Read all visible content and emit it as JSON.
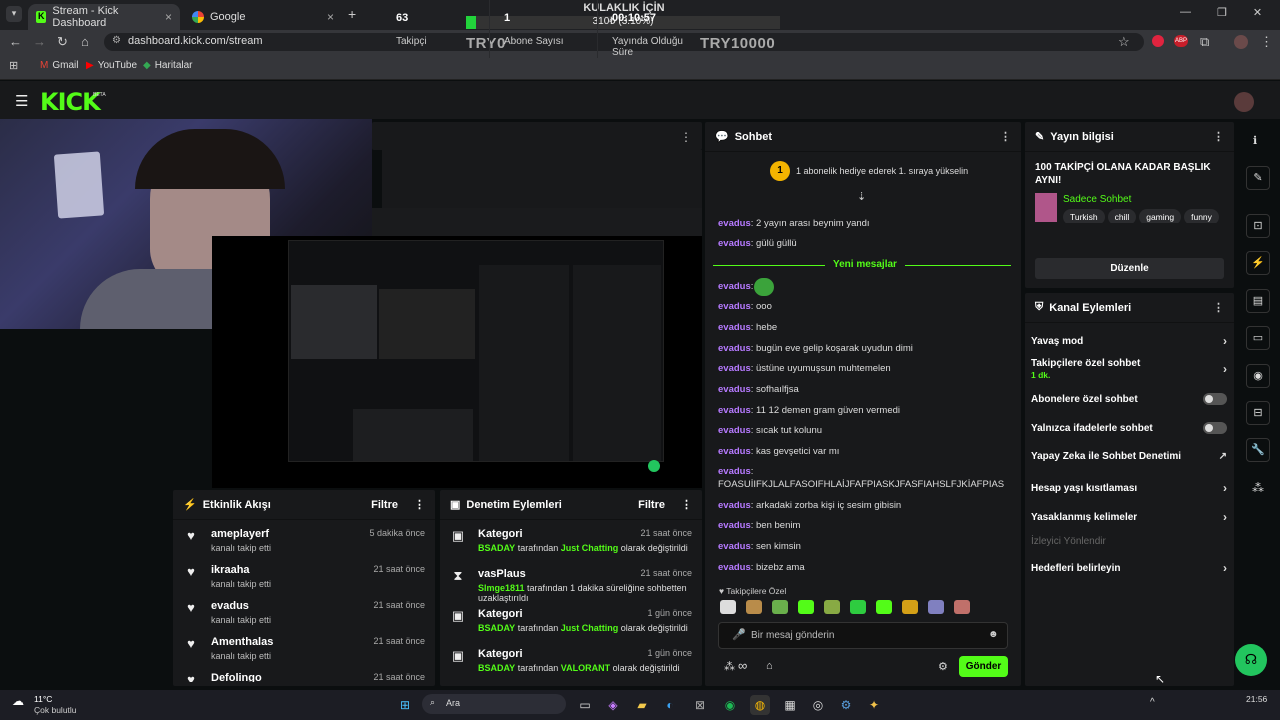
{
  "browser": {
    "tabs": [
      {
        "label": "Stream - Kick Dashboard"
      },
      {
        "label": "Google"
      }
    ],
    "url": "dashboard.kick.com/stream",
    "bookmarks": [
      "Gmail",
      "YouTube",
      "Haritalar"
    ]
  },
  "overlay": {
    "title": "KULAKLIK İÇİN",
    "progress_text": "310₺ (3.10%)",
    "progress_fraction": 0.031,
    "start_label": "TRY0",
    "goal_label": "TRY10000"
  },
  "header": {
    "logo": "KICK",
    "beta": "BETA"
  },
  "stats": [
    {
      "value": "63",
      "label": "Takipçi"
    },
    {
      "value": "1",
      "label": "Abone Sayısı"
    },
    {
      "value": "00:10:57",
      "label": "Yayında Olduğu Süre"
    }
  ],
  "activity": {
    "title": "Etkinlik Akışı",
    "filter": "Filtre",
    "items": [
      {
        "name": "ameplayerf",
        "sub": "kanalı takip etti",
        "time": "5 dakika önce"
      },
      {
        "name": "ikraaha",
        "sub": "kanalı takip etti",
        "time": "21 saat önce"
      },
      {
        "name": "evadus",
        "sub": "kanalı takip etti",
        "time": "21 saat önce"
      },
      {
        "name": "Amenthalas",
        "sub": "kanalı takip etti",
        "time": "21 saat önce"
      },
      {
        "name": "Defolingo",
        "sub": "",
        "time": "21 saat önce"
      }
    ]
  },
  "moderation": {
    "title": "Denetim Eylemleri",
    "filter": "Filtre",
    "items": [
      {
        "name": "Kategori",
        "actor": "BSADAY",
        "mid": " tarafından ",
        "target": "Just Chatting",
        "end": " olarak değiştirildi",
        "time": "21 saat önce"
      },
      {
        "name": "vasPlaus",
        "actor": "Slmge1811",
        "mid": " tarafından 1 dakika süreliğine sohbetten uzaklaştırıldı",
        "target": "",
        "end": "",
        "time": "21 saat önce"
      },
      {
        "name": "Kategori",
        "actor": "BSADAY",
        "mid": " tarafından ",
        "target": "Just Chatting",
        "end": " olarak değiştirildi",
        "time": "1 gün önce"
      },
      {
        "name": "Kategori",
        "actor": "BSADAY",
        "mid": " tarafından ",
        "target": "VALORANT",
        "end": " olarak değiştirildi",
        "time": "1 gün önce"
      }
    ]
  },
  "chat": {
    "title": "Sohbet",
    "banner": "1 abonelik hediye ederek 1. sıraya yükselin",
    "new_messages": "Yeni mesajlar",
    "messages_before": [
      {
        "user": "evadus",
        "text": ": 2 yayın arası beynim yandı"
      },
      {
        "user": "evadus",
        "text": ": gülü güllü"
      }
    ],
    "messages_after": [
      {
        "user": "evadus",
        "text": ":"
      },
      {
        "user": "evadus",
        "text": ": ooo"
      },
      {
        "user": "evadus",
        "text": ": hebe"
      },
      {
        "user": "evadus",
        "text": ": bugün eve gelip koşarak uyudun dimi"
      },
      {
        "user": "evadus",
        "text": ": üstüne uyumuşsun muhtemelen"
      },
      {
        "user": "evadus",
        "text": ": sofhaılfjsa"
      },
      {
        "user": "evadus",
        "text": ": 11 12 demen gram güven vermedi"
      },
      {
        "user": "evadus",
        "text": ": sıcak tut kolunu"
      },
      {
        "user": "evadus",
        "text": ": kas gevşetici var mı"
      },
      {
        "user": "evadus",
        "text": ": FOASUİIFKJLALFASOIFHLAİJFAFPIASKJFASFIAHSLFJKİAFPIAS"
      },
      {
        "user": "evadus",
        "text": ": arkadaki zorba kişi iç sesim gibisin"
      },
      {
        "user": "evadus",
        "text": ": ben benim"
      },
      {
        "user": "evadus",
        "text": ": sen kimsin"
      },
      {
        "user": "evadus",
        "text": ": bizebz ama"
      }
    ],
    "emote_label": "Takipçilere Özel",
    "input_placeholder": "Bir mesaj gönderin",
    "send": "Gönder"
  },
  "stream_info": {
    "title": "Yayın bilgisi",
    "stream_title": "100 TAKİPÇİ OLANA KADAR BAŞLIK AYNI!",
    "category": "Sadece Sohbet",
    "tags": [
      "Turkish",
      "chill",
      "gaming",
      "funny"
    ],
    "edit": "Düzenle"
  },
  "channel_actions": {
    "title": "Kanal Eylemleri",
    "items": [
      {
        "label": "Yavaş mod",
        "control": "chevron"
      },
      {
        "label": "Takipçilere özel sohbet",
        "sub": "1 dk.",
        "control": "chevron"
      },
      {
        "label": "Abonelere özel sohbet",
        "control": "toggle"
      },
      {
        "label": "Yalnızca ifadelerle sohbet",
        "control": "toggle"
      },
      {
        "label": "Yapay Zeka ile Sohbet Denetimi",
        "control": "external"
      },
      {
        "label": "Hesap yaşı kısıtlaması",
        "control": "chevron"
      },
      {
        "label": "Yasaklanmış kelimeler",
        "control": "chevron"
      },
      {
        "label": "İzleyici Yönlendir",
        "control": "disabled"
      },
      {
        "label": "Hedefleri belirleyin",
        "control": "chevron"
      }
    ]
  },
  "taskbar": {
    "weather_temp": "11°C",
    "weather_desc": "Çok bulutlu",
    "search": "Ara",
    "time": "21:56"
  },
  "colors": {
    "accent": "#53fc18",
    "username": "#b67aff",
    "panel": "#18191b"
  }
}
